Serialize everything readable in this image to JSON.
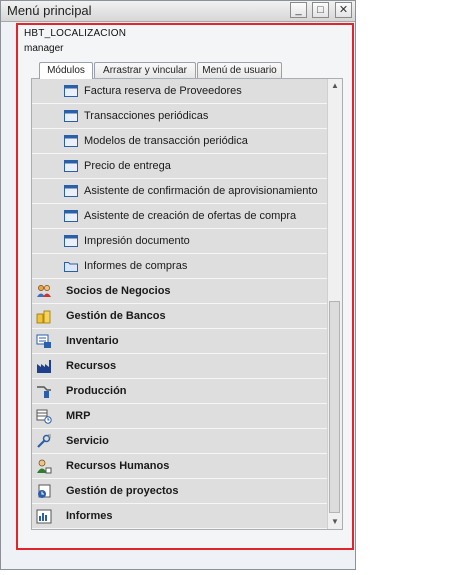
{
  "window": {
    "title": "Menú principal",
    "controls": {
      "minimize": "_",
      "maximize": "□",
      "close": "✕"
    }
  },
  "session": {
    "company": "HBT_LOCALIZACION",
    "user": "manager"
  },
  "tabs": [
    {
      "label": "Módulos",
      "active": true
    },
    {
      "label": "Arrastrar y vincular",
      "active": false
    },
    {
      "label": "Menú de usuario",
      "active": false
    }
  ],
  "submenu_items": [
    {
      "label": "Factura reserva de Proveedores",
      "icon": "form-icon"
    },
    {
      "label": "Transacciones periódicas",
      "icon": "form-icon"
    },
    {
      "label": "Modelos de transacción periódica",
      "icon": "form-icon"
    },
    {
      "label": "Precio de entrega",
      "icon": "form-icon"
    },
    {
      "label": "Asistente de confirmación de aprovisionamiento",
      "icon": "form-icon"
    },
    {
      "label": "Asistente de creación de ofertas de compra",
      "icon": "form-icon"
    },
    {
      "label": "Impresión documento",
      "icon": "form-icon"
    },
    {
      "label": "Informes de compras",
      "icon": "folder-icon"
    }
  ],
  "modules": [
    {
      "label": "Socios de Negocios",
      "icon": "people-icon"
    },
    {
      "label": "Gestión de Bancos",
      "icon": "coins-icon"
    },
    {
      "label": "Inventario",
      "icon": "inventory-icon"
    },
    {
      "label": "Recursos",
      "icon": "factory-icon"
    },
    {
      "label": "Producción",
      "icon": "production-icon"
    },
    {
      "label": "MRP",
      "icon": "mrp-icon"
    },
    {
      "label": "Servicio",
      "icon": "wrench-icon"
    },
    {
      "label": "Recursos Humanos",
      "icon": "person-icon"
    },
    {
      "label": "Gestión de proyectos",
      "icon": "project-icon"
    },
    {
      "label": "Informes",
      "icon": "report-chart-icon"
    }
  ],
  "colors": {
    "selection_border": "#e0262b",
    "row_bg": "#dedede",
    "icon_blue": "#2b5fa8"
  }
}
